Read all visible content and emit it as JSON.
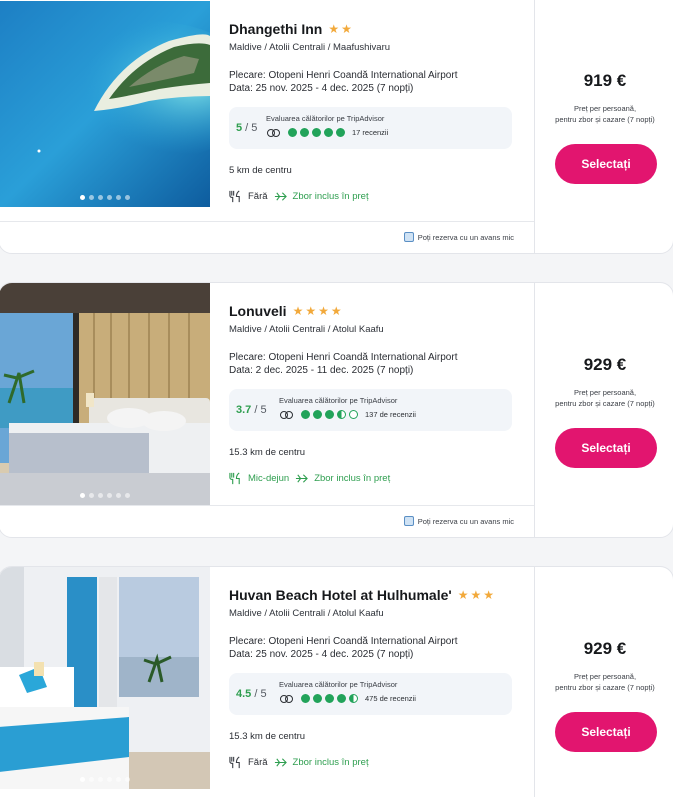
{
  "hotels": [
    {
      "name": "Dhangethi Inn",
      "stars": "★★",
      "location": "Maldive / Atolii Centrali / Maafushivaru",
      "departure": "Plecare: Otopeni Henri Coandă International Airport",
      "dates": "Data: 25 nov. 2025 - 4 dec. 2025 (7 nopți)",
      "score": "5",
      "score_of": " / 5",
      "ta_label": "Evaluarea călătorilor pe TripAdvisor",
      "bubbles": [
        "full",
        "full",
        "full",
        "full",
        "full"
      ],
      "reviews": "17 recenzii",
      "distance": "5 km de centru",
      "meal": "Fără",
      "flight": "Zbor inclus în preț",
      "avans": "Poți rezerva cu un avans mic",
      "price": "919 €",
      "price_note_1": "Preț per persoană,",
      "price_note_2": "pentru zbor și cazare (7 nopți)",
      "button": "Selectați",
      "photo_icon": "aerial-island-photo"
    },
    {
      "name": "Lonuveli",
      "stars": "★★★★",
      "location": "Maldive / Atolii Centrali / Atolul Kaafu",
      "departure": "Plecare: Otopeni Henri Coandă International Airport",
      "dates": "Data: 2 dec. 2025 - 11 dec. 2025 (7 nopți)",
      "score": "3.7",
      "score_of": " / 5",
      "ta_label": "Evaluarea călătorilor pe TripAdvisor",
      "bubbles": [
        "full",
        "full",
        "full",
        "half",
        "empty"
      ],
      "reviews": "137 de recenzii",
      "distance": "15.3 km de centru",
      "meal": "Mic-dejun",
      "flight": "Zbor inclus în preț",
      "avans": "Poți rezerva cu un avans mic",
      "price": "929 €",
      "price_note_1": "Preț per persoană,",
      "price_note_2": "pentru zbor și cazare (7 nopți)",
      "button": "Selectați",
      "photo_icon": "hotel-room-photo"
    },
    {
      "name": "Huvan Beach Hotel at Hulhumale'",
      "stars": "★★★",
      "location": "Maldive / Atolii Centrali / Atolul Kaafu",
      "departure": "Plecare: Otopeni Henri Coandă International Airport",
      "dates": "Data: 25 nov. 2025 - 4 dec. 2025 (7 nopți)",
      "score": "4.5",
      "score_of": " / 5",
      "ta_label": "Evaluarea călătorilor pe TripAdvisor",
      "bubbles": [
        "full",
        "full",
        "full",
        "full",
        "half"
      ],
      "reviews": "475 de recenzii",
      "distance": "15.3 km de centru",
      "meal": "Fără",
      "flight": "Zbor inclus în preț",
      "price": "929 €",
      "price_note_1": "Preț per persoană,",
      "price_note_2": "pentru zbor și cazare (7 nopți)",
      "button": "Selectați",
      "photo_icon": "hotel-room-photo"
    }
  ],
  "colors": {
    "accent": "#e2156f",
    "rating": "#22a35a",
    "star": "#f2a93b"
  }
}
